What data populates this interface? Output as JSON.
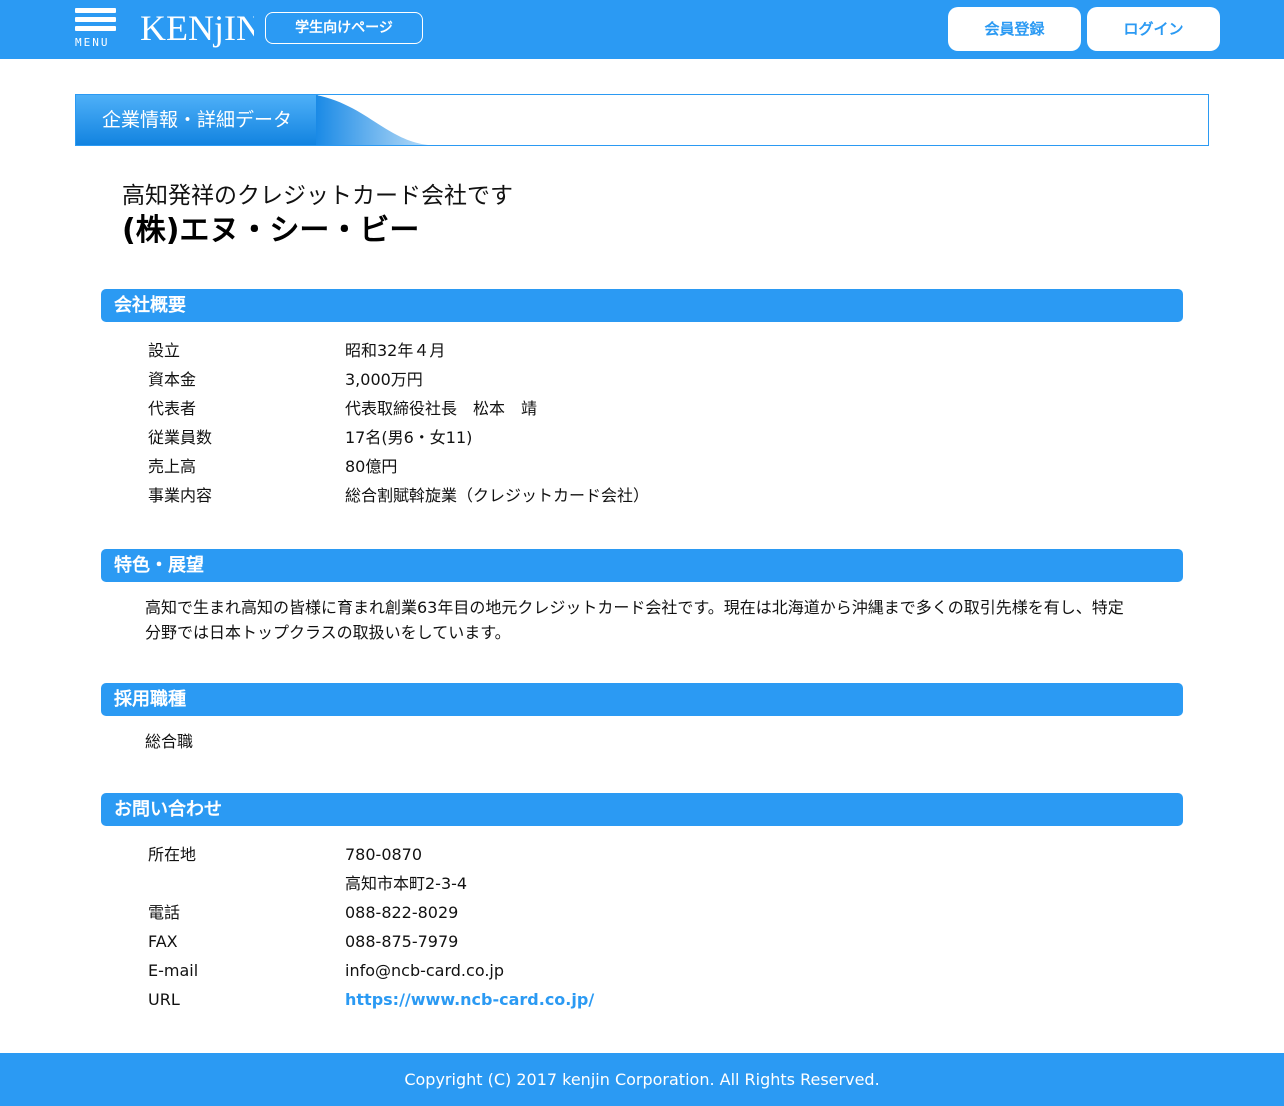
{
  "header": {
    "menu_label": "MENU",
    "logo_text": "KENjIN",
    "student_page_button": "学生向けページ",
    "register_button": "会員登録",
    "login_button": "ログイン"
  },
  "banner": {
    "title": "企業情報・詳細データ"
  },
  "company": {
    "tagline": "高知発祥のクレジットカード会社です",
    "name": "(株)エヌ・シー・ビー"
  },
  "overview": {
    "heading": "会社概要",
    "rows": [
      {
        "label": "設立",
        "value": "昭和32年４月"
      },
      {
        "label": "資本金",
        "value": "3,000万円"
      },
      {
        "label": "代表者",
        "value": "代表取締役社長　松本　靖"
      },
      {
        "label": "従業員数",
        "value": "17名(男6・女11)"
      },
      {
        "label": "売上高",
        "value": "80億円"
      },
      {
        "label": "事業内容",
        "value": "総合割賦斡旋業（クレジットカード会社）"
      }
    ]
  },
  "features": {
    "heading": "特色・展望",
    "text": "高知で生まれ高知の皆様に育まれ創業63年目の地元クレジットカード会社です。現在は北海道から沖縄まで多くの取引先様を有し、特定分野では日本トップクラスの取扱いをしています。"
  },
  "recruitment": {
    "heading": "採用職種",
    "text": "総合職"
  },
  "contact": {
    "heading": "お問い合わせ",
    "rows": [
      {
        "label": "所在地",
        "value": "780-0870"
      },
      {
        "label": "",
        "value": "高知市本町2-3-4"
      },
      {
        "label": "電話",
        "value": "088-822-8029"
      },
      {
        "label": "FAX",
        "value": "088-875-7979"
      },
      {
        "label": "E-mail",
        "value": "info@ncb-card.co.jp"
      },
      {
        "label": "URL",
        "value": "https://www.ncb-card.co.jp/"
      }
    ]
  },
  "footer": {
    "copyright": "Copyright (C) 2017 kenjin Corporation. All Rights Reserved."
  },
  "colors": {
    "brand_blue": "#2b9af3",
    "white": "#ffffff",
    "text": "#111111"
  }
}
